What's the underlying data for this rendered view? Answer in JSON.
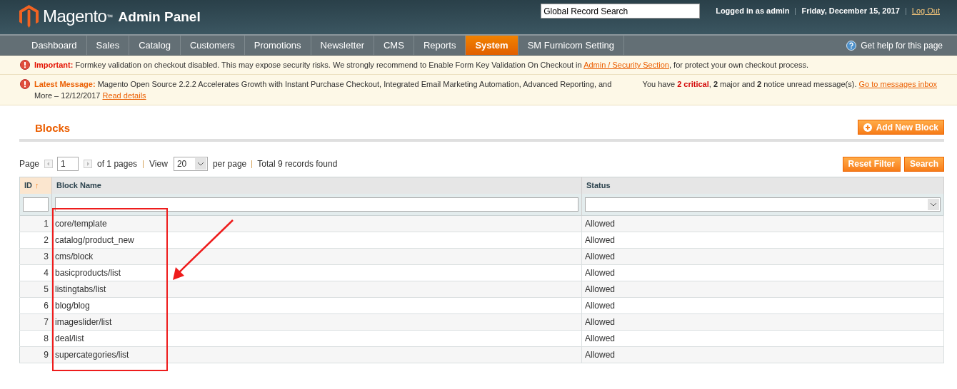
{
  "header": {
    "logo": "Magento",
    "logo_tm": "™",
    "subtitle": "Admin Panel",
    "search": {
      "value": "Global Record Search"
    },
    "user": "Logged in as admin",
    "date": "Friday, December 15, 2017",
    "logout": "Log Out"
  },
  "nav": {
    "items": [
      {
        "label": "Dashboard",
        "selected": false
      },
      {
        "label": "Sales",
        "selected": false
      },
      {
        "label": "Catalog",
        "selected": false
      },
      {
        "label": "Customers",
        "selected": false
      },
      {
        "label": "Promotions",
        "selected": false
      },
      {
        "label": "Newsletter",
        "selected": false
      },
      {
        "label": "CMS",
        "selected": false
      },
      {
        "label": "Reports",
        "selected": false
      },
      {
        "label": "System",
        "selected": true
      },
      {
        "label": "SM Furnicom Setting",
        "selected": false
      }
    ],
    "help": "Get help for this page"
  },
  "messages": [
    {
      "label": "Important:",
      "kind": "important",
      "text": "Formkey validation on checkout disabled. This may expose security risks. We strongly recommend to Enable Form Key Validation On Checkout in",
      "link": "Admin / Security Section",
      "after": ", for protect your own checkout process."
    },
    {
      "label": "Latest Message:",
      "kind": "latest",
      "text": "Magento Open Source 2.2.2 Accelerates Growth with Instant Purchase Checkout, Integrated Email Marketing Automation, Advanced Reporting, and More –",
      "date": "12/12/2017",
      "link": "Read details",
      "notice": [
        {
          "text": "You have ",
          "kind": "plain"
        },
        {
          "text": "2 critical",
          "kind": "critical"
        },
        {
          "text": ", ",
          "kind": "plain"
        },
        {
          "text": "2",
          "kind": "bold"
        },
        {
          "text": " major and ",
          "kind": "plain"
        },
        {
          "text": "2",
          "kind": "bold"
        },
        {
          "text": " notice unread message(s). ",
          "kind": "plain"
        }
      ],
      "notice_link": "Go to messages inbox"
    }
  ],
  "page": {
    "title": "Blocks",
    "add_button": "Add New Block"
  },
  "pager": {
    "page_label": "Page",
    "page": "1",
    "of_pages": "of 1 pages",
    "view_label": "View",
    "view": "20",
    "per_page": "per page",
    "total": "Total 9 records found",
    "reset": "Reset Filter",
    "search": "Search"
  },
  "table": {
    "columns": [
      {
        "label": "ID",
        "sorted": true,
        "sort_arrow": "↑"
      },
      {
        "label": "Block Name",
        "sorted": false
      },
      {
        "label": "Status",
        "sorted": false
      }
    ],
    "rows": [
      [
        "1",
        "core/template",
        "Allowed"
      ],
      [
        "2",
        "catalog/product_new",
        "Allowed"
      ],
      [
        "3",
        "cms/block",
        "Allowed"
      ],
      [
        "4",
        "basicproducts/list",
        "Allowed"
      ],
      [
        "5",
        "listingtabs/list",
        "Allowed"
      ],
      [
        "6",
        "blog/blog",
        "Allowed"
      ],
      [
        "7",
        "imageslider/list",
        "Allowed"
      ],
      [
        "8",
        "deal/list",
        "Allowed"
      ],
      [
        "9",
        "supercategories/list",
        "Allowed"
      ]
    ]
  }
}
